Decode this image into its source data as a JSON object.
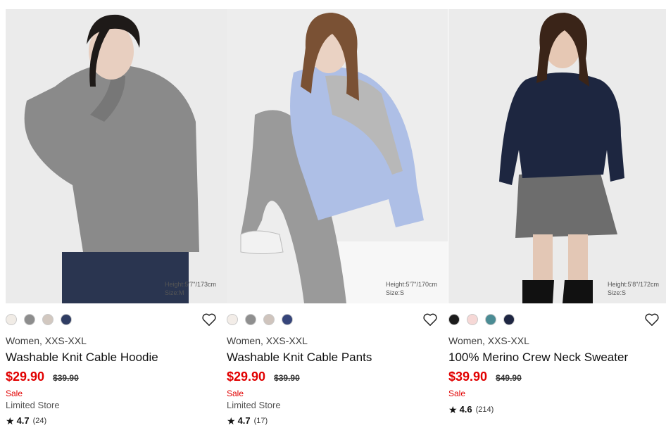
{
  "products": [
    {
      "photo_caption": [
        "Height:5'7\"/173cm",
        "Size:M"
      ],
      "swatches": [
        "#f1ece6",
        "#8d8d8d",
        "#d2c8c0",
        "#2f3d63"
      ],
      "gender_size": "Women, XXS-XXL",
      "name": "Washable Knit Cable Hoodie",
      "price": "$29.90",
      "original_price": "$39.90",
      "badge": "Sale",
      "store": "Limited Store",
      "rating": "4.7",
      "review_count": "(24)",
      "favorite_icon": "heart-outline-icon"
    },
    {
      "photo_caption": [
        "Height:5'7\"/170cm",
        "Size:S"
      ],
      "swatches": [
        "#f3ede8",
        "#8f8f8f",
        "#cfc4bd",
        "#36457a"
      ],
      "gender_size": "Women, XXS-XXL",
      "name": "Washable Knit Cable Pants",
      "price": "$29.90",
      "original_price": "$39.90",
      "badge": "Sale",
      "store": "Limited Store",
      "rating": "4.7",
      "review_count": "(17)",
      "favorite_icon": "heart-outline-icon"
    },
    {
      "photo_caption": [
        "Height:5'8\"/172cm",
        "Size:S"
      ],
      "swatches": [
        "#1b1b1b",
        "#f6d8d6",
        "#4b8c94",
        "#1e2642"
      ],
      "gender_size": "Women, XXS-XXL",
      "name": "100% Merino Crew Neck Sweater",
      "price": "$39.90",
      "original_price": "$49.90",
      "badge": "Sale",
      "store": "",
      "rating": "4.6",
      "review_count": "(214)",
      "favorite_icon": "heart-outline-icon"
    }
  ],
  "colors": {
    "sale": "#e10000",
    "text": "#1b1b1b"
  }
}
